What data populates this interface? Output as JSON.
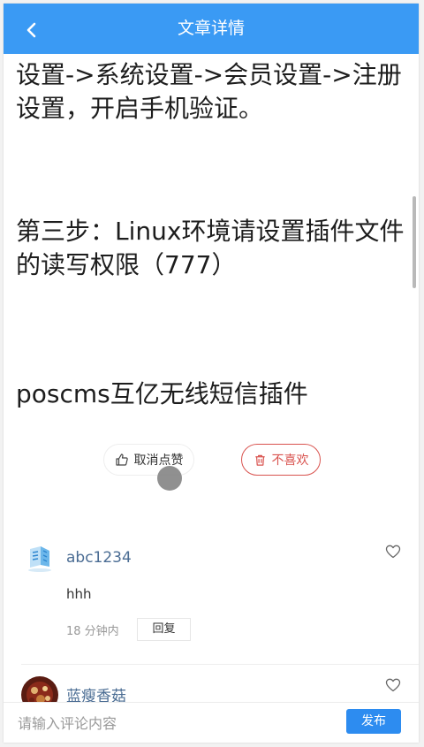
{
  "header": {
    "title": "文章详情",
    "back_icon": "chevron-left-icon"
  },
  "article": {
    "paragraphs": [
      "设置->系统设置->会员设置->注册设置，开启手机验证。",
      "第三步：Linux环境请设置插件文件的读写权限（777）",
      "poscms互亿无线短信插件"
    ]
  },
  "actions": {
    "like_label": "取消点赞",
    "like_icon": "thumbs-up-icon",
    "dislike_label": "不喜欢",
    "dislike_icon": "trash-icon"
  },
  "comments": [
    {
      "username": "abc1234",
      "text": "hhh",
      "time": "18 分钟内",
      "reply_label": "回复",
      "avatar_icon": "logo-avatar-icon"
    },
    {
      "username": "蓝瘦香菇",
      "avatar_icon": "photo-avatar-icon"
    }
  ],
  "composer": {
    "placeholder": "请输入评论内容",
    "publish_label": "发布"
  },
  "colors": {
    "primary": "#3a9af4",
    "publish": "#2d8cf0",
    "danger": "#d9534f",
    "username": "#4a6c93"
  }
}
